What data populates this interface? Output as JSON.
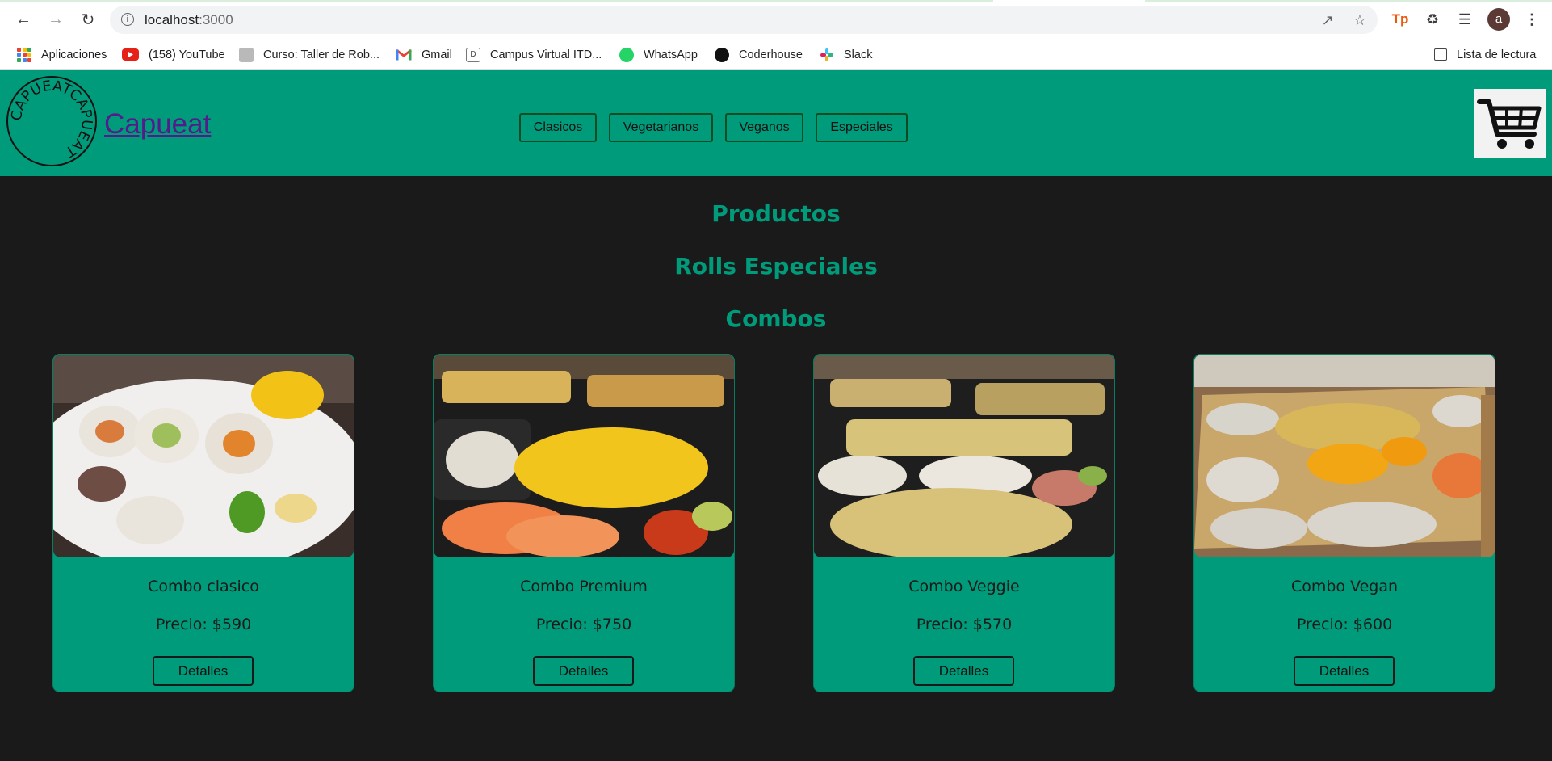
{
  "browser": {
    "url_host": "localhost",
    "url_port": ":3000",
    "bookmarks": [
      {
        "label": "Aplicaciones",
        "icon": "apps-grid-icon"
      },
      {
        "label": "(158) YouTube",
        "icon": "youtube-icon"
      },
      {
        "label": "Curso: Taller de Rob...",
        "icon": "course-icon"
      },
      {
        "label": "Gmail",
        "icon": "gmail-icon"
      },
      {
        "label": "Campus Virtual ITD...",
        "icon": "campus-icon"
      },
      {
        "label": "WhatsApp",
        "icon": "whatsapp-icon"
      },
      {
        "label": "Coderhouse",
        "icon": "coderhouse-icon"
      },
      {
        "label": "Slack",
        "icon": "slack-icon"
      }
    ],
    "reading_list": "Lista de lectura",
    "profile_initial": "a",
    "extension_tp": "Tp"
  },
  "header": {
    "logo_text": "CAPUEATCAPUEAT",
    "brand": "Capueat",
    "nav": [
      "Clasicos",
      "Vegetarianos",
      "Veganos",
      "Especiales"
    ]
  },
  "main": {
    "headings": [
      "Productos",
      "Rolls Especiales",
      "Combos"
    ],
    "products": [
      {
        "name": "Combo clasico",
        "price": "Precio: $590",
        "button": "Detalles",
        "image": "sushi-plate-photo"
      },
      {
        "name": "Combo Premium",
        "price": "Precio: $750",
        "button": "Detalles",
        "image": "sushi-trays-salmon-photo"
      },
      {
        "name": "Combo Veggie",
        "price": "Precio: $570",
        "button": "Detalles",
        "image": "sushi-trays-veggie-photo"
      },
      {
        "name": "Combo Vegan",
        "price": "Precio: $600",
        "button": "Detalles",
        "image": "sushi-board-flowers-photo"
      }
    ]
  },
  "colors": {
    "accent": "#009b7a",
    "page_bg": "#1a1a1a",
    "link": "#551a8b"
  }
}
